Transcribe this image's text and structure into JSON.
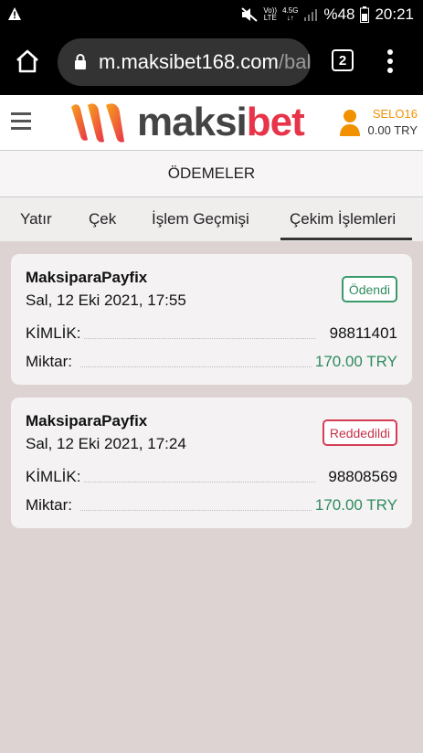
{
  "status_bar": {
    "network_top": "Vo))",
    "network_bottom": "LTE",
    "signal_top": "4.5G",
    "battery": "%48",
    "time": "20:21"
  },
  "browser": {
    "url_host": "m.maksibet168.com",
    "url_rest": "/bal",
    "tab_count": "2"
  },
  "site": {
    "logo_dark": "maksi",
    "logo_red": "bet",
    "username": "SELO16",
    "balance": "0.00 TRY"
  },
  "page": {
    "title": "ÖDEMELER"
  },
  "tabs": [
    {
      "label": "Yatır",
      "active": false
    },
    {
      "label": "Çek",
      "active": false
    },
    {
      "label": "İşlem Geçmişi",
      "active": false
    },
    {
      "label": "Çekim İşlemleri",
      "active": true
    }
  ],
  "transactions": [
    {
      "method": "MaksiparaPayfix",
      "date": "Sal, 12 Eki 2021, 17:55",
      "status": "Ödendi",
      "id_label": "KİMLİK:",
      "id_value": "98811401",
      "amount_label": "Miktar:",
      "amount_value": "170.00 TRY"
    },
    {
      "method": "MaksiparaPayfix",
      "date": "Sal, 12 Eki 2021, 17:24",
      "status": "Reddedildi",
      "id_label": "KİMLİK:",
      "id_value": "98808569",
      "amount_label": "Miktar:",
      "amount_value": "170.00 TRY"
    }
  ],
  "colors": {
    "accent_orange": "#f29100",
    "brand_red": "#e8344a",
    "paid_green": "#2e8b5f",
    "rejected_red": "#c8304a"
  }
}
